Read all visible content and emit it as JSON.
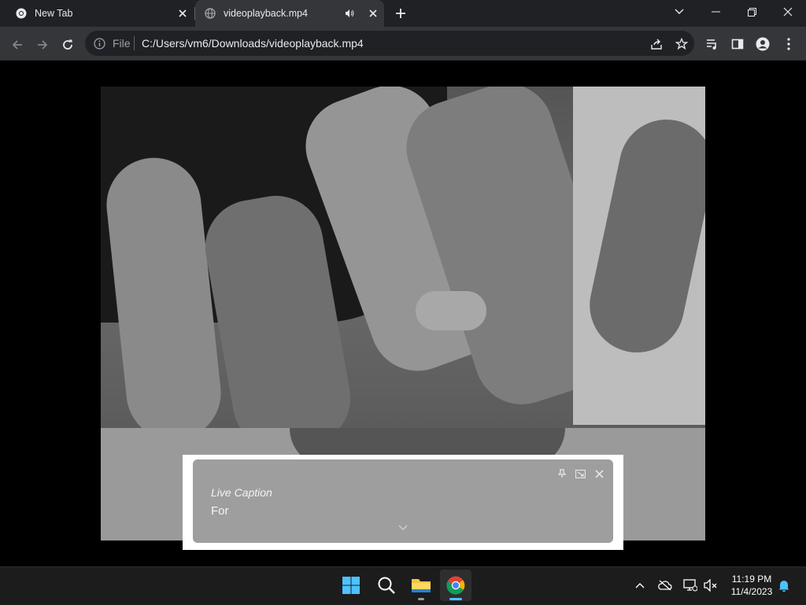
{
  "browser": {
    "tabs": [
      {
        "title": "New Tab",
        "active": false
      },
      {
        "title": "videoplayback.mp4",
        "active": true,
        "audio_playing": true
      }
    ],
    "omnibox": {
      "scheme_label": "File",
      "url": "C:/Users/vm6/Downloads/videoplayback.mp4"
    },
    "icons": {
      "back": "arrow-left-icon",
      "forward": "arrow-right-icon",
      "reload": "reload-icon",
      "info": "info-icon",
      "share": "share-icon",
      "bookmark": "star-icon",
      "media": "media-control-icon",
      "side_panel": "side-panel-icon",
      "profile": "profile-icon",
      "menu": "kebab-menu-icon"
    },
    "colors": {
      "tabstrip": "#202124",
      "toolbar": "#35363a",
      "omnibox": "#202124",
      "text": "#e8eaed"
    }
  },
  "live_caption": {
    "heading": "Live Caption",
    "text": "For"
  },
  "taskbar": {
    "apps": [
      "start-icon",
      "search-icon",
      "file-explorer-icon",
      "chrome-icon"
    ],
    "clock": {
      "time": "11:19 PM",
      "date": "11/4/2023"
    },
    "accent": "#4cc2ff"
  }
}
